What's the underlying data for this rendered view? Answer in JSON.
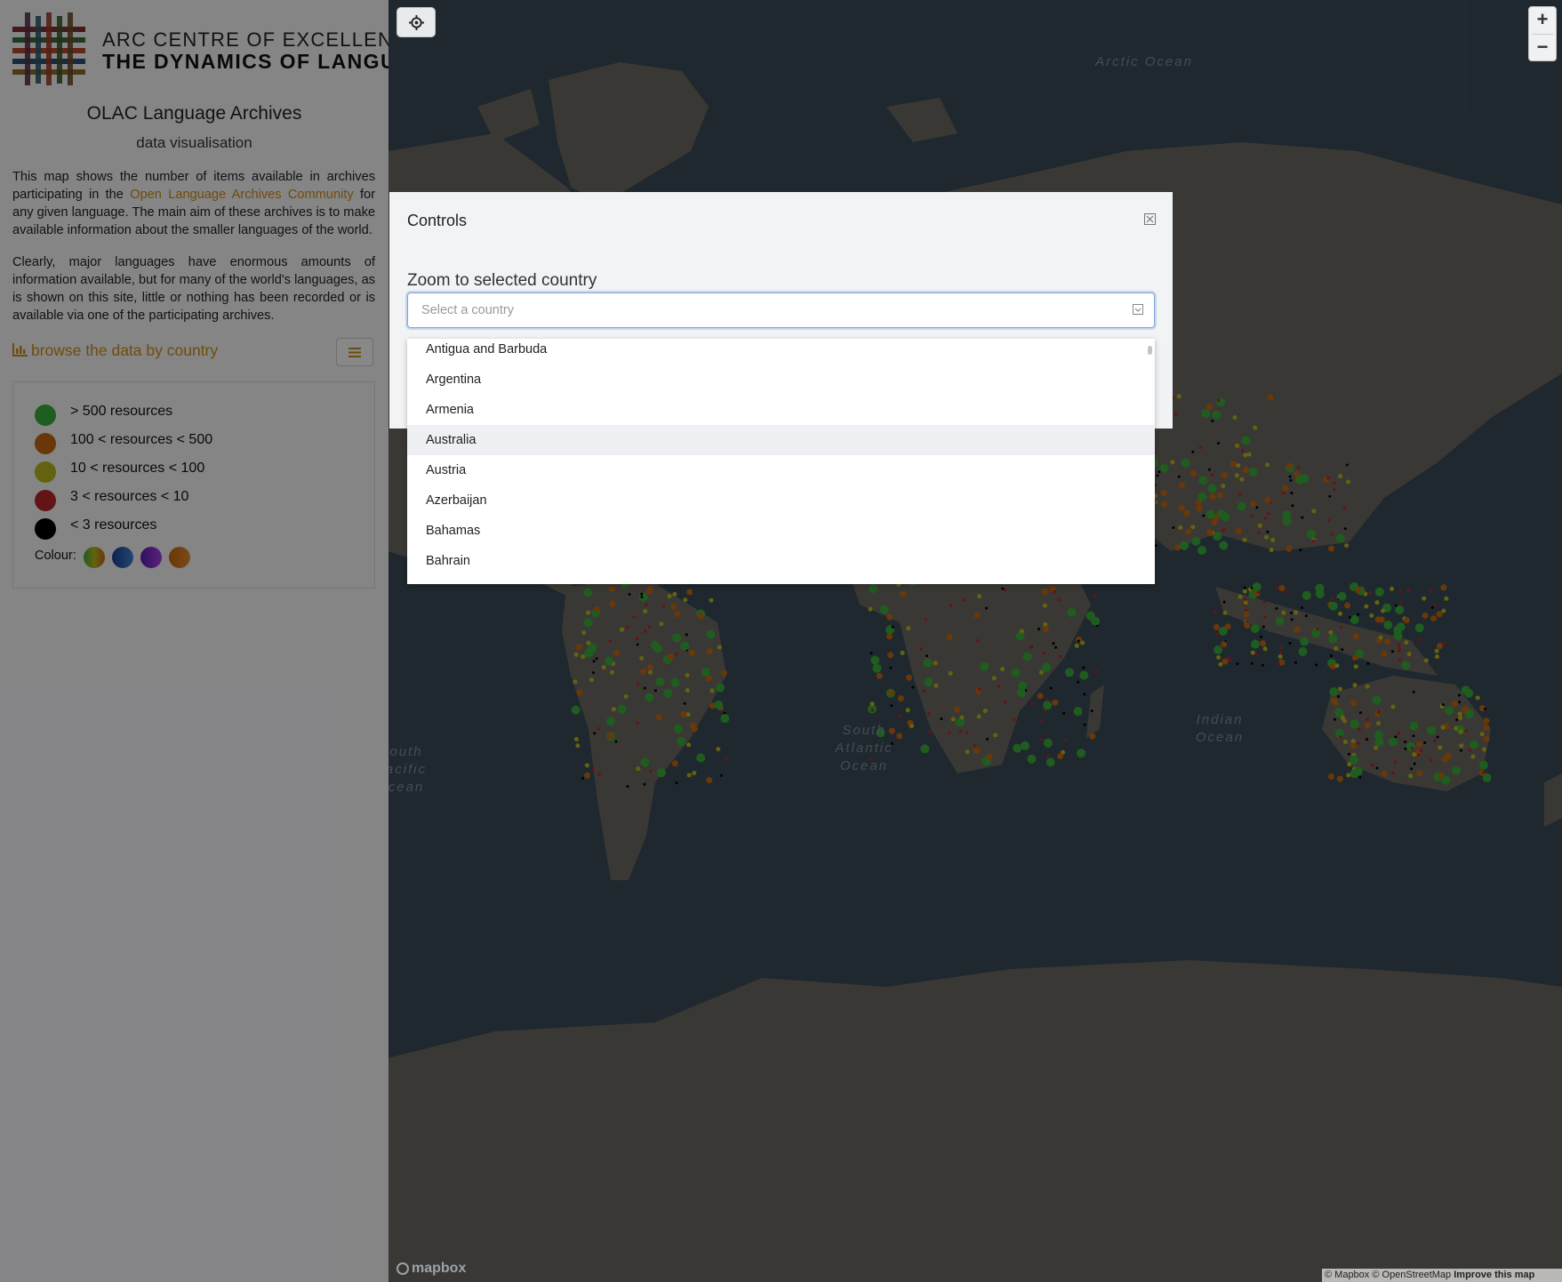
{
  "sidebar": {
    "logo": {
      "line1": "ARC CENTRE OF EXCELLENCE FOR",
      "line2": "THE DYNAMICS OF LANGUAGE"
    },
    "title": "OLAC Language Archives",
    "subtitle": "data visualisation",
    "para1_before": "This map shows the number of items available in archives participating in the ",
    "para1_link": "Open Language Archives Community",
    "para1_after": " for any given language. The main aim of these archives is to make available information about the smaller languages of the world.",
    "para2": "Clearly, major languages have enormous amounts of information available, but for many of the world's languages, as is shown on this site, little or nothing has been recorded or is available via one of the participating archives.",
    "browse_label": "browse the data by country",
    "legend": {
      "items": [
        {
          "label": "> 500 resources",
          "color": "#3aa83a"
        },
        {
          "label": "100 < resources < 500",
          "color": "#c2650f"
        },
        {
          "label": "10 < resources < 100",
          "color": "#b5b51c"
        },
        {
          "label": "3 < resources < 10",
          "color": "#b5262a"
        },
        {
          "label": "< 3 resources",
          "color": "#000000"
        }
      ],
      "colour_label": "Colour:"
    }
  },
  "map": {
    "oceans": {
      "arctic": "Arctic Ocean",
      "south_atlantic": "South Atlantic Ocean",
      "indian": "Indian Ocean",
      "south_pacific_partial": "outh acific cean"
    },
    "attribution_main": "© Mapbox © OpenStreetMap ",
    "attribution_improve": "Improve this map",
    "mapbox_logo": "mapbox",
    "zoom_in": "+",
    "zoom_out": "−"
  },
  "modal": {
    "title": "Controls",
    "zoom_label": "Zoom to selected country",
    "select_placeholder": "Select a country",
    "options": [
      "Antigua and Barbuda",
      "Argentina",
      "Armenia",
      "Australia",
      "Austria",
      "Azerbaijan",
      "Bahamas",
      "Bahrain"
    ],
    "highlighted_option": "Australia"
  }
}
